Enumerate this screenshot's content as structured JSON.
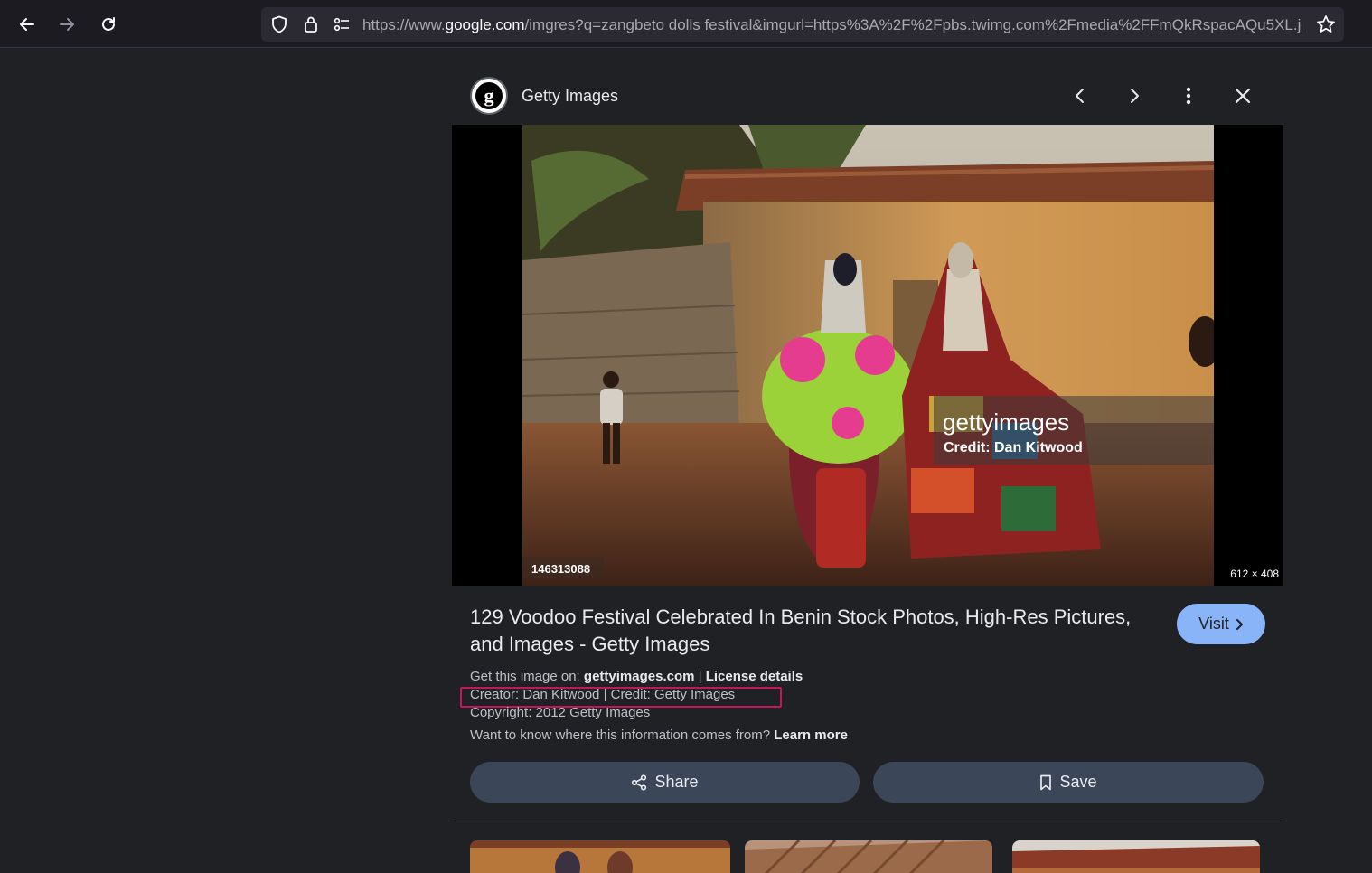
{
  "browser": {
    "url_prefix": "https://www.",
    "url_host": "google.com",
    "url_rest": "/imgres?q=zangbeto dolls festival&imgurl=https%3A%2F%2Fpbs.twimg.com%2Fmedia%2FFmQkRspacAQu5XL.jp",
    "icons": [
      "back-arrow-icon",
      "forward-arrow-icon",
      "reload-icon",
      "shield-icon",
      "lock-icon",
      "permissions-icon",
      "star-icon"
    ]
  },
  "panel": {
    "source_logo_letter": "g",
    "source_name": "Getty Images",
    "image": {
      "watermark_brand": "gettyimages",
      "watermark_credit": "Credit: Dan Kitwood",
      "image_id": "146313088",
      "dimensions": "612 × 408"
    },
    "title": "129 Voodoo Festival Celebrated In Benin Stock Photos, High-Res Pictures, and Images - Getty Images",
    "visit_label": "Visit",
    "meta": {
      "get_image_prefix": "Get this image on: ",
      "get_image_site": "gettyimages.com",
      "separator": " | ",
      "license_label": "License details",
      "creator_line": "Creator: Dan Kitwood | Credit: Getty Images",
      "copyright_line": "Copyright: 2012 Getty Images",
      "info_question": "Want to know where this information comes from? ",
      "learn_more": "Learn more"
    },
    "share_label": "Share",
    "save_label": "Save",
    "colors": {
      "accent": "#8ab4f8",
      "button_bg": "#3c4659",
      "highlight": "#c2185b"
    }
  }
}
